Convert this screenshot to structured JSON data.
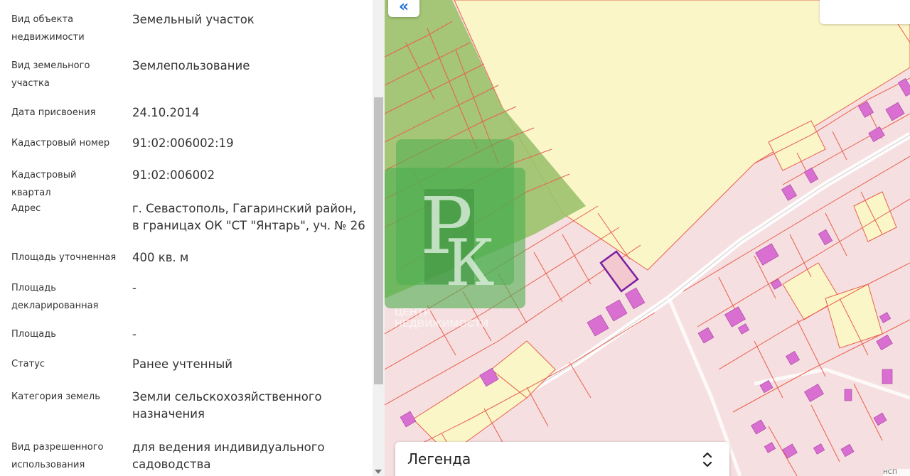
{
  "properties": [
    {
      "label": "Вид объекта недвижимости",
      "value": "Земельный участок"
    },
    {
      "label": "Вид земельного участка",
      "value": "Землепользование"
    },
    {
      "label": "Дата присвоения",
      "value": "24.10.2014"
    },
    {
      "label": "Кадастровый номер",
      "value": "91:02:006002:19"
    },
    {
      "label": "Кадастровый квартал",
      "value": "91:02:006002"
    },
    {
      "label": "Адрес",
      "value": "г. Севастополь, Гагаринский район, в границах ОК \"СТ \"Янтарь\", уч. № 26"
    },
    {
      "label": "Площадь уточненная",
      "value": "400 кв. м"
    },
    {
      "label": "Площадь декларированная",
      "value": "-"
    },
    {
      "label": "Площадь",
      "value": "-"
    },
    {
      "label": "Статус",
      "value": "Ранее учтенный"
    },
    {
      "label": "Категория земель",
      "value": "Земли сельскохозяйственного назначения"
    },
    {
      "label": "Вид разрешенного использования",
      "value": "для ведения индивидуального садоводства"
    }
  ],
  "map": {
    "collapse_label": "«",
    "legend_title": "Легенда",
    "watermark_letters": "РК",
    "watermark_caption_1": "ЦЕНТР",
    "watermark_caption_2": "НЕДВИЖИМОСТИ",
    "attribution": "НСП"
  },
  "icons": {
    "collapse": "double-chevron-left-icon",
    "legend_toggle": "chevron-up-down-icon"
  },
  "colors": {
    "accent": "#1f6fd6",
    "parcel_fill": "#f6dfe0",
    "parcel_border": "#e8604c",
    "field_yellow": "#faf6c8",
    "forest_green": "#8fbf5e",
    "building": "#d96fd0",
    "selected_parcel": "#7b1fa2",
    "watermark_green": "#4caf50"
  }
}
